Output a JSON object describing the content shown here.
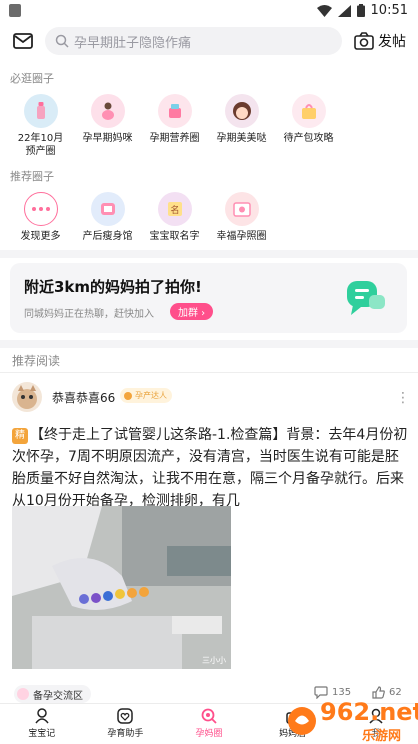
{
  "status_bar": {
    "time": "10:51"
  },
  "header": {
    "search_placeholder": "孕早期肚子隐隐作痛",
    "post_label": "发帖"
  },
  "must_visit": {
    "title": "必逛圈子",
    "items": [
      {
        "label_line1": "22年10月",
        "label_line2": "预产圈",
        "icon": "baby-bottle-icon"
      },
      {
        "label_line1": "孕早期妈咪",
        "label_line2": "",
        "icon": "pregnant-mom-icon"
      },
      {
        "label_line1": "孕期营养圈",
        "label_line2": "",
        "icon": "nutrition-icon"
      },
      {
        "label_line1": "孕期美美哒",
        "label_line2": "",
        "icon": "beauty-icon"
      },
      {
        "label_line1": "待产包攻略",
        "label_line2": "",
        "icon": "bag-icon"
      }
    ]
  },
  "recommended_circles": {
    "title": "推荐圈子",
    "items": [
      {
        "label": "发现更多",
        "icon": "more-dots-icon"
      },
      {
        "label": "产后瘦身馆",
        "icon": "slim-icon"
      },
      {
        "label": "宝宝取名字",
        "icon": "name-icon"
      },
      {
        "label": "幸福孕照圈",
        "icon": "photo-icon"
      }
    ]
  },
  "nearby": {
    "title": "附近3km的妈妈拍了拍你!",
    "subtitle": "同城妈妈正在热聊，赶快加入",
    "join_label": "加群 ›"
  },
  "recommended_reading": {
    "title": "推荐阅读",
    "post": {
      "author": "恭喜恭喜66",
      "badge": "孕产达人",
      "jing": "精",
      "text": "【终于走上了试管婴儿这条路-1.检查篇】背景：去年4月份初次怀孕，7周不明原因流产，没有清宫，当时医生说有可能是胚胎质量不好自然淘汰，让我不用在意，隔三个月备孕就行。后来从10月份开始备孕，检测排卵，有几",
      "image_caption": "三小小",
      "tag": "备孕交流区",
      "comments": "135",
      "likes": "62"
    }
  },
  "tabbar": {
    "tabs": [
      {
        "label": "宝宝记"
      },
      {
        "label": "孕育助手"
      },
      {
        "label": "孕妈圈"
      },
      {
        "label": "妈妈店"
      },
      {
        "label": "我"
      }
    ],
    "active_index": 2
  },
  "watermark": {
    "brand": "962.net",
    "site": "乐游网"
  },
  "colors": {
    "accent": "#ff4f8b",
    "badge": "#e9a23b",
    "jing": "#f3a43b"
  }
}
